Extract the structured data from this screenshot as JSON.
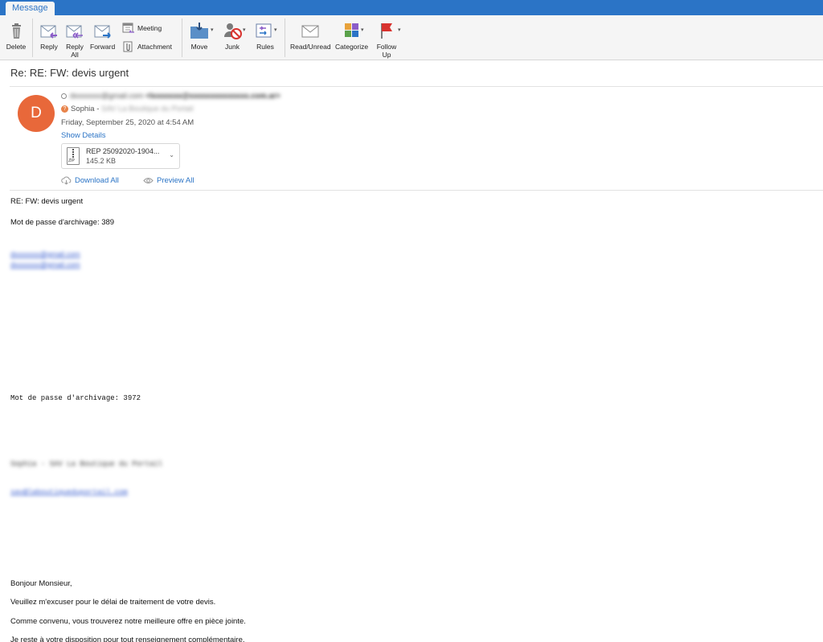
{
  "window": {
    "tab_label": "Message"
  },
  "ribbon": {
    "delete": "Delete",
    "reply": "Reply",
    "reply_all": "Reply All",
    "forward": "Forward",
    "meeting": "Meeting",
    "attachment": "Attachment",
    "move": "Move",
    "junk": "Junk",
    "rules": "Rules",
    "read_unread": "Read/Unread",
    "categorize": "Categorize",
    "follow_up": "Follow Up"
  },
  "email": {
    "subject": "Re: RE: FW: devis urgent",
    "avatar_letter": "D",
    "from_name": "dxxxxxxx@gmail.com",
    "from_address": "<lxxxxxxx@xxxxxxxxxxxxxx.com.ar>",
    "to_name": "Sophia -",
    "to_detail": "SAV La Boutique du Portail",
    "date": "Friday, September 25, 2020 at 4:54 AM",
    "show_details": "Show Details",
    "attachment": {
      "name": "REP 25092020-1904...",
      "size": "145.2 KB",
      "type": "ZIP"
    },
    "download_all": "Download All",
    "preview_all": "Preview All"
  },
  "body": {
    "line1": "RE: FW: devis urgent",
    "line2": "Mot de passe d'archivage: 389",
    "link1": "dxxxxxxx@gmail.com",
    "link2": "dxxxxxxx@gmail.com",
    "mono_line": "Mot de passe d'archivage: 3972",
    "signature_blur": "Sophia - SAV La Boutique du Portail",
    "signature_link": "sav@laboutiqueduportail.com",
    "p1": "Bonjour Monsieur,",
    "p2": "Veuillez m'excuser pour le délai de traitement de votre devis.",
    "p3": "Comme convenu, vous trouverez notre meilleure offre en pièce jointe.",
    "p4": "Je reste à votre disposition pour tout renseignement complémentaire."
  },
  "colors": {
    "accent": "#2b74c6",
    "avatar": "#e8683a",
    "flag": "#d8322e"
  }
}
